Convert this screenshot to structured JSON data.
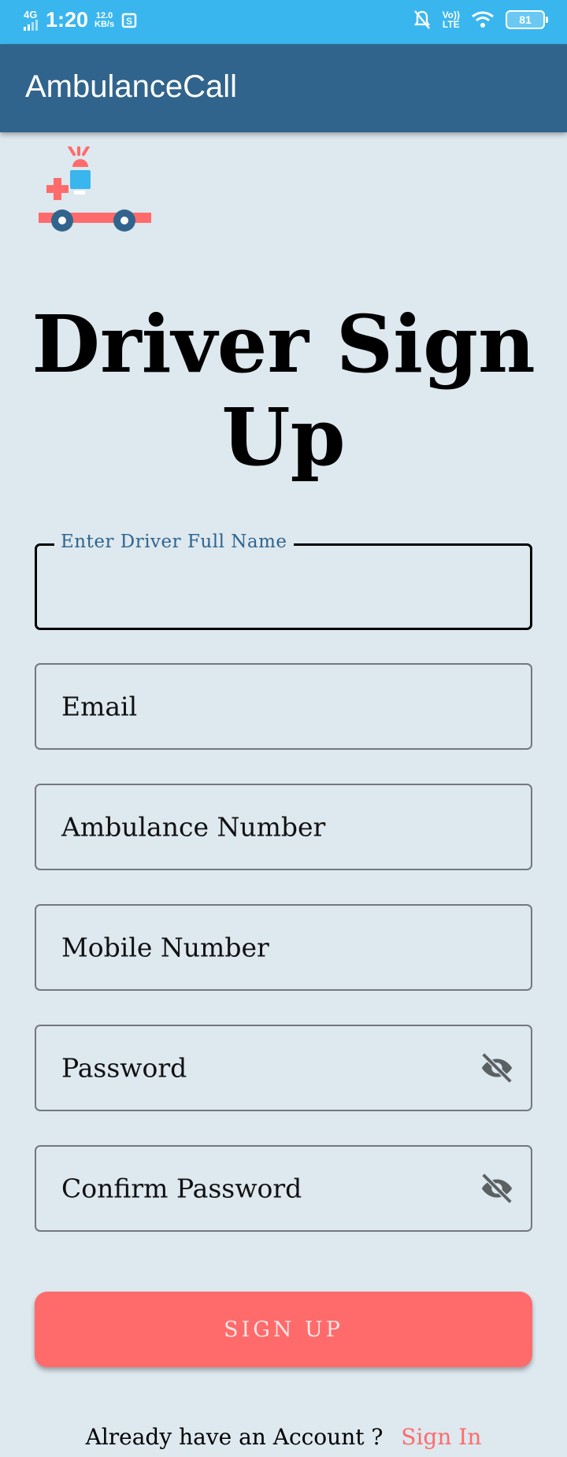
{
  "status_bar": {
    "network": "4G",
    "time": "1:20",
    "speed_value": "12.0",
    "speed_unit": "KB/s",
    "volte_top": "Vo))",
    "volte_bottom": "LTE",
    "battery": "81"
  },
  "app_bar": {
    "title": "AmbulanceCall"
  },
  "logo": {
    "icon": "ambulance-icon"
  },
  "page": {
    "title": "Driver Sign Up"
  },
  "form": {
    "full_name": {
      "label": "Enter Driver Full Name",
      "value": ""
    },
    "email": {
      "label": "Email"
    },
    "ambulance_number": {
      "label": "Ambulance Number"
    },
    "mobile_number": {
      "label": "Mobile Number"
    },
    "password": {
      "label": "Password",
      "icon": "eye-off-icon"
    },
    "confirm_password": {
      "label": "Confirm Password",
      "icon": "eye-off-icon"
    },
    "submit_label": "SIGN UP"
  },
  "footer": {
    "prompt": "Already have an Account ?",
    "link": "Sign In"
  },
  "colors": {
    "status_bar": "#3ab6ef",
    "app_bar": "#31648c",
    "background": "#dde8ef",
    "accent": "#ff6b6b"
  }
}
